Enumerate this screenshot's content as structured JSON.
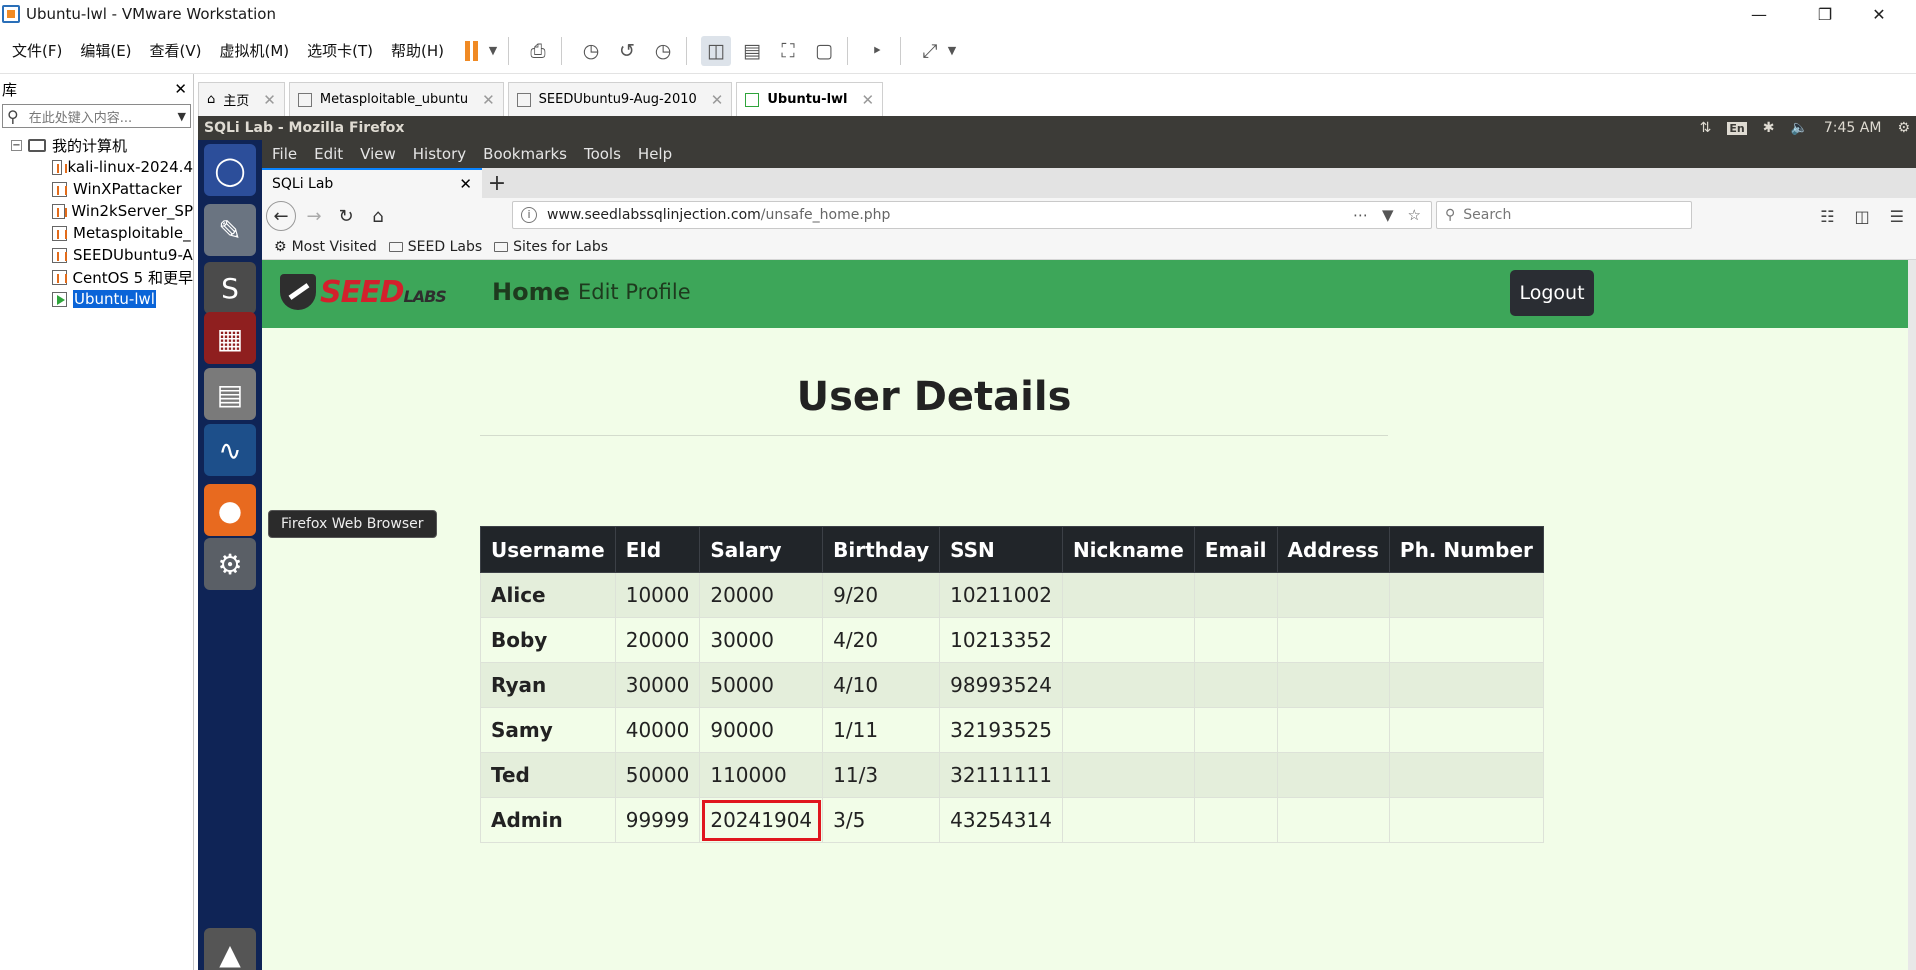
{
  "window": {
    "title": "Ubuntu-lwl - VMware Workstation"
  },
  "vm_menu": [
    "文件(F)",
    "编辑(E)",
    "查看(V)",
    "虚拟机(M)",
    "选项卡(T)",
    "帮助(H)"
  ],
  "library": {
    "title": "库",
    "search_placeholder": "在此处键入内容...",
    "root": "我的计算机",
    "items": [
      "kali-linux-2024.4",
      "WinXPattacker",
      "Win2kServer_SP",
      "Metasploitable_",
      "SEEDUbuntu9-A",
      "CentOS 5 和更早",
      "Ubuntu-lwl"
    ]
  },
  "vm_tabs": [
    "主页",
    "Metasploitable_ubuntu",
    "SEEDUbuntu9-Aug-2010",
    "Ubuntu-lwl"
  ],
  "ubuntu": {
    "window_title": "SQLi Lab - Mozilla Firefox",
    "lang": "En",
    "time": "7:45 AM",
    "tooltip": "Firefox Web Browser"
  },
  "firefox": {
    "menu": [
      "File",
      "Edit",
      "View",
      "History",
      "Bookmarks",
      "Tools",
      "Help"
    ],
    "tab_title": "SQLi Lab",
    "url_host": "www.seedlabssqlinjection.com",
    "url_path": "/unsafe_home.php",
    "search_placeholder": "Search",
    "bookmarks": [
      "Most Visited",
      "SEED Labs",
      "Sites for Labs"
    ]
  },
  "site": {
    "logo_main": "SEED",
    "logo_sub": "LABS",
    "nav_home": "Home",
    "nav_edit": "Edit Profile",
    "logout": "Logout",
    "heading": "User Details"
  },
  "table": {
    "headers": [
      "Username",
      "EId",
      "Salary",
      "Birthday",
      "SSN",
      "Nickname",
      "Email",
      "Address",
      "Ph. Number"
    ],
    "rows": [
      [
        "Alice",
        "10000",
        "20000",
        "9/20",
        "10211002",
        "",
        "",
        "",
        ""
      ],
      [
        "Boby",
        "20000",
        "30000",
        "4/20",
        "10213352",
        "",
        "",
        "",
        ""
      ],
      [
        "Ryan",
        "30000",
        "50000",
        "4/10",
        "98993524",
        "",
        "",
        "",
        ""
      ],
      [
        "Samy",
        "40000",
        "90000",
        "1/11",
        "32193525",
        "",
        "",
        "",
        ""
      ],
      [
        "Ted",
        "50000",
        "110000",
        "11/3",
        "32111111",
        "",
        "",
        "",
        ""
      ],
      [
        "Admin",
        "99999",
        "20241904",
        "3/5",
        "43254314",
        "",
        "",
        "",
        ""
      ]
    ],
    "highlight_color": "#e0161e"
  },
  "colors": {
    "seed_green": "#3da659",
    "page_bg": "#f2fde8",
    "launcher": "#0f2456"
  }
}
